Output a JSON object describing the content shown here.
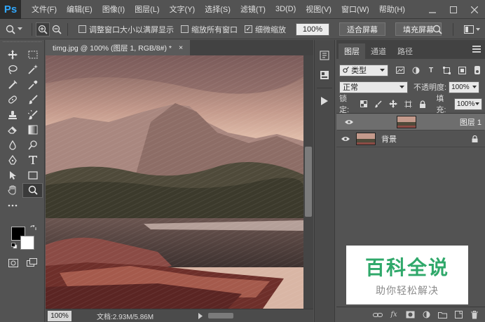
{
  "app": {
    "logo": "Ps"
  },
  "menu": [
    "文件(F)",
    "编辑(E)",
    "图像(I)",
    "图层(L)",
    "文字(Y)",
    "选择(S)",
    "滤镜(T)",
    "3D(D)",
    "视图(V)",
    "窗口(W)",
    "帮助(H)"
  ],
  "options": {
    "resize_windows": "调整窗口大小以满屏显示",
    "zoom_all": "缩放所有窗口",
    "scrubby_zoom": "细微缩放",
    "zoom_percent": "100%",
    "fit_screen": "适合屏幕",
    "fill_screen": "填充屏幕",
    "resize_checked": false,
    "zoom_all_checked": false,
    "scrubby_checked": true
  },
  "document": {
    "tab_title": "timg.jpg @ 100% (图层 1, RGB/8#) *",
    "close": "×",
    "zoom": "100%",
    "doc_info": "文档:2.93M/5.86M"
  },
  "layers_panel": {
    "tabs": [
      "图层",
      "通道",
      "路径"
    ],
    "filter_kind": "类型",
    "blend_mode": "正常",
    "opacity_label": "不透明度:",
    "opacity_value": "100%",
    "lock_label": "锁定:",
    "fill_label": "填充:",
    "fill_value": "100%",
    "layers": [
      {
        "name": "图层 1",
        "selected": true,
        "locked": false
      },
      {
        "name": "背景",
        "selected": false,
        "locked": true
      }
    ]
  },
  "watermark": {
    "main": "百科全说",
    "sub": "助你轻松解决"
  },
  "colors": {
    "ps_blue": "#31a8ff",
    "watermark_green": "#2fa86a",
    "panel_bg": "#535353"
  }
}
